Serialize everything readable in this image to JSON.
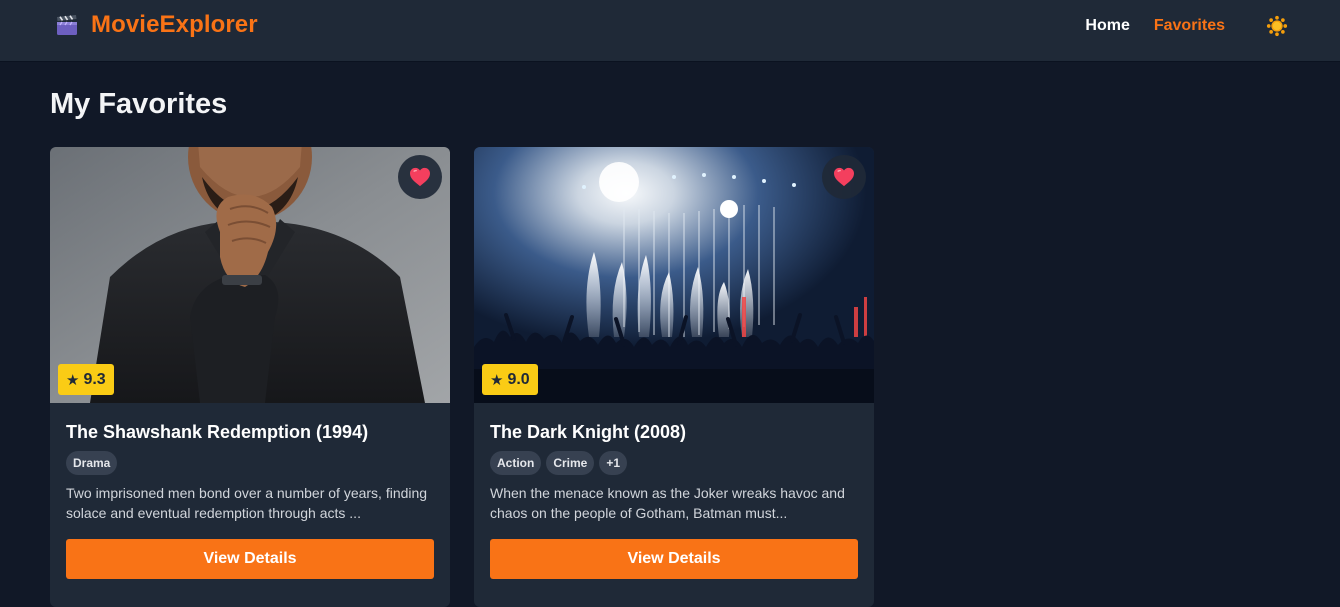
{
  "app": {
    "brand_name": "MovieExplorer",
    "brand_icon": "clapperboard-icon",
    "accent_color": "#f97316"
  },
  "nav": {
    "home_label": "Home",
    "favorites_label": "Favorites",
    "active": "Favorites",
    "theme_toggle_icon": "sun-icon"
  },
  "page": {
    "title": "My Favorites"
  },
  "movies": [
    {
      "title": "The Shawshank Redemption (1994)",
      "rating": "9.3",
      "genres": [
        "Drama"
      ],
      "description": "Two imprisoned men bond over a number of years, finding solace and eventual redemption through acts ...",
      "button_label": "View Details",
      "favorite": true,
      "favorite_icon": "heart-icon",
      "poster": "man-in-dark-shirt-photo"
    },
    {
      "title": "The Dark Knight (2008)",
      "rating": "9.0",
      "genres": [
        "Action",
        "Crime",
        "+1"
      ],
      "description": "When the menace known as the Joker wreaks havoc and chaos on the people of Gotham, Batman must...",
      "button_label": "View Details",
      "favorite": true,
      "favorite_icon": "heart-icon",
      "poster": "concert-crowd-photo"
    }
  ]
}
